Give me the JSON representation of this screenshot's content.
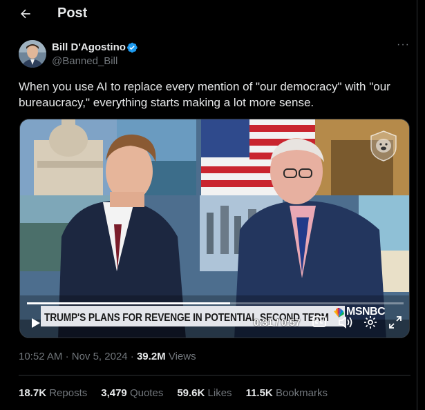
{
  "header": {
    "title": "Post"
  },
  "author": {
    "name": "Bill D'Agostino",
    "handle": "@Banned_Bill",
    "verified": true
  },
  "post": {
    "text": "When you use AI to replace every mention of \"our democracy\" with \"our bureaucracy,\" everything starts making a lot more sense."
  },
  "video": {
    "chyron": "TRUMP'S PLANS FOR REVENGE IN POTENTIAL SECOND TERM",
    "network": "MSNBC",
    "time": "0:31 / 0:57",
    "progress": 0.54
  },
  "meta": {
    "time": "10:52 AM",
    "date": "Nov 5, 2024",
    "views_count": "39.2M",
    "views_label": "Views"
  },
  "stats": {
    "reposts_count": "18.7K",
    "reposts_label": "Reposts",
    "quotes_count": "3,479",
    "quotes_label": "Quotes",
    "likes_count": "59.6K",
    "likes_label": "Likes",
    "bookmarks_count": "11.5K",
    "bookmarks_label": "Bookmarks"
  },
  "colors": {
    "verified": "#1d9bf0",
    "text": "#e7e9ea",
    "muted": "#71767b",
    "background": "#000000"
  }
}
